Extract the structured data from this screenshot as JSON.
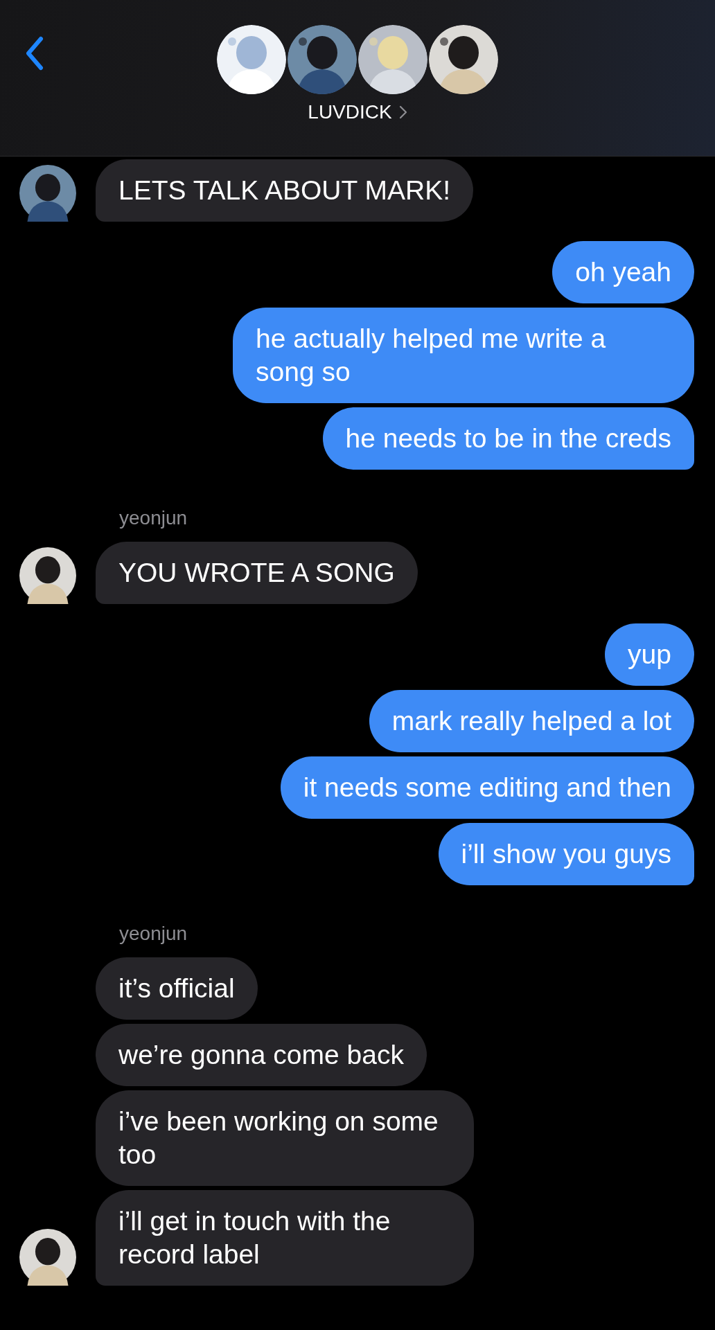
{
  "header": {
    "title": "LUVDICK"
  },
  "groups": [
    {
      "kind": "incoming",
      "messages": [
        "LETS TALK ABOUT MARK!"
      ]
    },
    {
      "kind": "outgoing",
      "messages": [
        "oh yeah",
        "he actually helped me write a song so",
        "he needs to be in the creds"
      ]
    },
    {
      "kind": "incoming",
      "sender": "yeonjun",
      "messages": [
        "YOU WROTE A SONG"
      ]
    },
    {
      "kind": "outgoing",
      "messages": [
        "yup",
        "mark really helped a lot",
        "it needs some editing and then",
        "i’ll show you guys"
      ]
    },
    {
      "kind": "incoming",
      "sender": "yeonjun",
      "messages": [
        "it’s official",
        "we’re gonna come back",
        "i’ve been working on some too",
        "i’ll get in touch with the record label"
      ]
    }
  ]
}
